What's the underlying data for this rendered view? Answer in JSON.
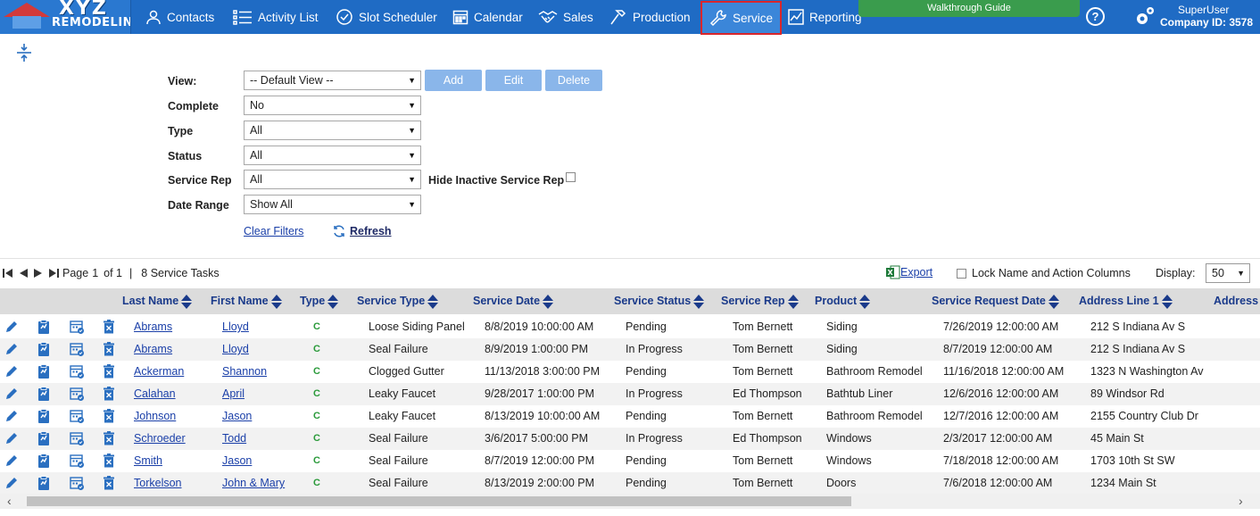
{
  "brand": {
    "line1": "XYZ",
    "line2": "REMODELING"
  },
  "nav": {
    "items": [
      {
        "label": "Contacts",
        "icon": "person-icon"
      },
      {
        "label": "Activity List",
        "icon": "list-icon"
      },
      {
        "label": "Slot Scheduler",
        "icon": "check-circle-icon"
      },
      {
        "label": "Calendar",
        "icon": "calendar-icon"
      },
      {
        "label": "Sales",
        "icon": "handshake-icon"
      },
      {
        "label": "Production",
        "icon": "hammer-icon"
      },
      {
        "label": "Service",
        "icon": "wrench-icon",
        "active": true
      },
      {
        "label": "Reporting",
        "icon": "chart-icon"
      }
    ],
    "walkthrough": "Walkthrough Guide",
    "help": "?",
    "user": "SuperUser",
    "company_id": "Company ID: 3578",
    "active_color": "#d9262c",
    "bar_color": "#1f6bc4"
  },
  "filters": {
    "view_label": "View:",
    "view_value": "-- Default View --",
    "add_label": "Add",
    "edit_label": "Edit",
    "delete_label": "Delete",
    "complete_label": "Complete",
    "complete_value": "No",
    "type_label": "Type",
    "type_value": "All",
    "status_label": "Status",
    "status_value": "All",
    "rep_label": "Service Rep",
    "rep_value": "All",
    "hide_inactive_label": "Hide Inactive Service Rep",
    "date_label": "Date Range",
    "date_value": "Show All",
    "clear_label": "Clear Filters",
    "refresh_label": "Refresh"
  },
  "pager": {
    "page_label": "Page",
    "page_current": "1",
    "page_of": "of 1",
    "separator": "|",
    "task_count": "8 Service Tasks",
    "export_label": "Export",
    "lock_label": "Lock Name and Action Columns",
    "display_label": "Display:",
    "display_value": "50"
  },
  "grid": {
    "headers": [
      "Last Name",
      "First Name",
      "Type",
      "Service Type",
      "Service Date",
      "Service Status",
      "Service Rep",
      "Product",
      "Service Request Date",
      "Address Line 1",
      "Address"
    ],
    "rows": [
      {
        "last": "Abrams",
        "first": "Lloyd",
        "type": "C",
        "stype": "Loose Siding Panel",
        "sdate": "8/8/2019 10:00:00 AM",
        "status": "Pending",
        "rep": "Tom Bernett",
        "product": "Siding",
        "reqdate": "7/26/2019 12:00:00 AM",
        "addr": "212 S Indiana Av S"
      },
      {
        "last": "Abrams",
        "first": "Lloyd",
        "type": "C",
        "stype": "Seal Failure",
        "sdate": "8/9/2019 1:00:00 PM",
        "status": "In Progress",
        "rep": "Tom Bernett",
        "product": "Siding",
        "reqdate": "8/7/2019 12:00:00 AM",
        "addr": "212 S Indiana Av S"
      },
      {
        "last": "Ackerman",
        "first": "Shannon",
        "type": "C",
        "stype": "Clogged Gutter",
        "sdate": "11/13/2018 3:00:00 PM",
        "status": "Pending",
        "rep": "Tom Bernett",
        "product": "Bathroom Remodel",
        "reqdate": "11/16/2018 12:00:00 AM",
        "addr": "1323 N Washington Av"
      },
      {
        "last": "Calahan",
        "first": "April",
        "type": "C",
        "stype": "Leaky Faucet",
        "sdate": "9/28/2017 1:00:00 PM",
        "status": "In Progress",
        "rep": "Ed Thompson",
        "product": "Bathtub Liner",
        "reqdate": "12/6/2016 12:00:00 AM",
        "addr": "89 Windsor Rd"
      },
      {
        "last": "Johnson",
        "first": "Jason",
        "type": "C",
        "stype": "Leaky Faucet",
        "sdate": "8/13/2019 10:00:00 AM",
        "status": "Pending",
        "rep": "Tom Bernett",
        "product": "Bathroom Remodel",
        "reqdate": "12/7/2016 12:00:00 AM",
        "addr": "2155 Country Club Dr"
      },
      {
        "last": "Schroeder",
        "first": "Todd",
        "type": "C",
        "stype": "Seal Failure",
        "sdate": "3/6/2017 5:00:00 PM",
        "status": "In Progress",
        "rep": "Ed Thompson",
        "product": "Windows",
        "reqdate": "2/3/2017 12:00:00 AM",
        "addr": "45 Main St"
      },
      {
        "last": "Smith",
        "first": "Jason",
        "type": "C",
        "stype": "Seal Failure",
        "sdate": "8/7/2019 12:00:00 PM",
        "status": "Pending",
        "rep": "Tom Bernett",
        "product": "Windows",
        "reqdate": "7/18/2018 12:00:00 AM",
        "addr": "1703 10th St SW"
      },
      {
        "last": "Torkelson",
        "first": "John & Mary",
        "type": "C",
        "stype": "Seal Failure",
        "sdate": "8/13/2019 2:00:00 PM",
        "status": "Pending",
        "rep": "Tom Bernett",
        "product": "Doors",
        "reqdate": "7/6/2018 12:00:00 AM",
        "addr": "1234 Main St"
      }
    ]
  }
}
